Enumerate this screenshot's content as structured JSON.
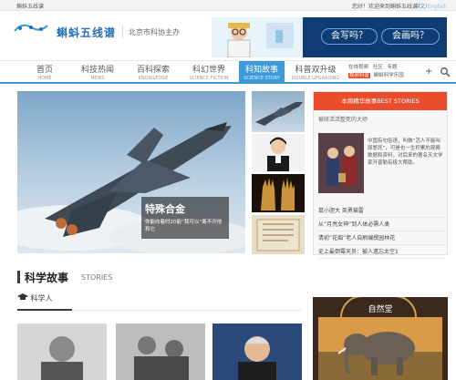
{
  "topbar": {
    "site_name": "蝌蚪五线谱",
    "greeting": "您好！欢迎来到蝌蚪五线谱！",
    "lang_cn": "中文",
    "lang_sep": "/",
    "lang_en": "English"
  },
  "header": {
    "logo_text": "蝌蚪五线谱",
    "org": "北京市科协主办",
    "banner_q1": "会写吗？",
    "banner_q2": "会画吗？"
  },
  "nav": {
    "items": [
      {
        "cn": "首页",
        "en": "HOME"
      },
      {
        "cn": "科技热闻",
        "en": "NEWS"
      },
      {
        "cn": "百科探索",
        "en": "KNOWLEDGE"
      },
      {
        "cn": "科幻世界",
        "en": "SCIENCE FICTION"
      },
      {
        "cn": "科知故事",
        "en": "SCIENCE STORY"
      },
      {
        "cn": "科普双升级",
        "en": "DOUBLE UPGRADING"
      }
    ],
    "sub": [
      "在线视频",
      "社区",
      "专题",
      "视频科普",
      "蝌蚪科学乐园"
    ]
  },
  "hero": {
    "title": "特殊合金",
    "desc": "你能向着时20能“我可以”离不开他和它"
  },
  "panel": {
    "header": "本周精华故事BEST STORIES",
    "subtitle": "被研活活整死的大师",
    "desc": "中国有句俗语，叫做“活人不能叫尿憋死”，可是也一生积累的观察数据和资料，对后来的著名天文学家开普勒有极大帮助。",
    "list": [
      "鼠小胆大 英勇猫雷",
      "从“月亮女神”到人体必需人类",
      "清初“花痴”老人自刷编撰园林花",
      "史上最倒霉天员：被人遗忘太空1"
    ]
  },
  "section": {
    "title": "科学故事",
    "title_en": "STORIES",
    "tab": "科学人"
  },
  "nature": {
    "label": "自然堂"
  },
  "colors": {
    "accent_blue": "#3d9ad6",
    "accent_red": "#e84e2b",
    "banner_navy": "#0e3c73"
  }
}
